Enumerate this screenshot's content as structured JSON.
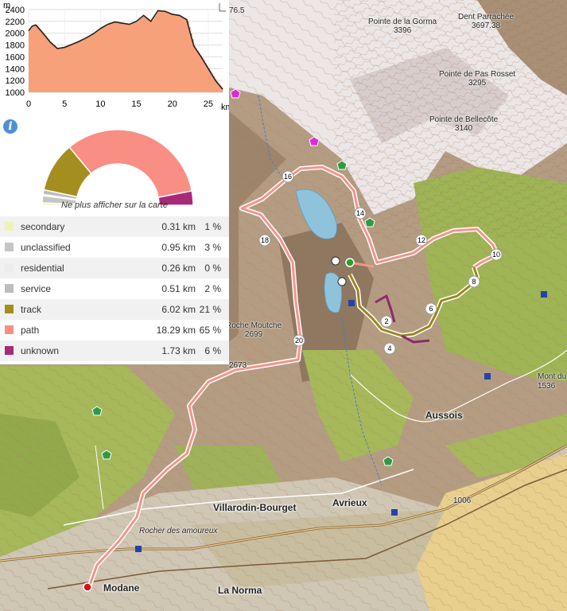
{
  "map": {
    "peaks": [
      {
        "name": "Pointe de la Gorma",
        "alt": "3396"
      },
      {
        "name": "Dent Parrachée",
        "alt": "3697.38"
      },
      {
        "name": "Pointe de Pas Rosset",
        "alt": "3295"
      },
      {
        "name": "Pointe de Bellecôte",
        "alt": "3140"
      },
      {
        "name": "Roche Moutche",
        "alt": "2699"
      }
    ],
    "towns": [
      "Aussois",
      "Villarodin-Bourget",
      "Avrieux",
      "Modane",
      "La Norma"
    ],
    "places": [
      "Rocher des amoureux",
      "Mont du",
      "Aussois"
    ],
    "spot_heights": [
      "2673",
      "1536",
      "76.5",
      "1006"
    ],
    "route_markers": [
      "2",
      "4",
      "6",
      "8",
      "10",
      "12",
      "14",
      "16",
      "18",
      "20"
    ],
    "colors": {
      "route_path": "#f4948c",
      "route_track": "#9a861e",
      "route_unknown": "#8c2a6e",
      "start": "#d11",
      "end": "#2aa02a"
    }
  },
  "elevation": {
    "y_unit": "m",
    "y_ticks": [
      "2400",
      "2200",
      "2000",
      "1800",
      "1600",
      "1400",
      "1200",
      "1000"
    ],
    "x_ticks": [
      "0",
      "5",
      "10",
      "15",
      "20",
      "25"
    ],
    "x_unit": "km"
  },
  "surface": {
    "hide_label": "Ne plus afficher sur la carte",
    "rows": [
      {
        "name": "secondary",
        "km": "0.31 km",
        "pct": "1 %",
        "frac": 0.01,
        "color": "#eef2b8"
      },
      {
        "name": "unclassified",
        "km": "0.95 km",
        "pct": "3 %",
        "frac": 0.03,
        "color": "#c6c6c6"
      },
      {
        "name": "residential",
        "km": "0.26 km",
        "pct": "0 %",
        "frac": 0.005,
        "color": "#ececec"
      },
      {
        "name": "service",
        "km": "0.51 km",
        "pct": "2 %",
        "frac": 0.02,
        "color": "#bdbdbd"
      },
      {
        "name": "track",
        "km": "6.02 km",
        "pct": "21 %",
        "frac": 0.21,
        "color": "#a48e1f"
      },
      {
        "name": "path",
        "km": "18.29 km",
        "pct": "65 %",
        "frac": 0.65,
        "color": "#f98e84"
      },
      {
        "name": "unknown",
        "km": "1.73 km",
        "pct": "6 %",
        "frac": 0.06,
        "color": "#a82a78"
      }
    ]
  },
  "chart_data": {
    "type": "bar",
    "xlabel": "",
    "ylabel": "",
    "x_unit": "km",
    "y_unit": "m",
    "xlim": [
      0,
      27
    ],
    "ylim": [
      1000,
      2400
    ],
    "x": [
      0,
      0.5,
      1,
      2,
      3,
      4,
      5,
      6,
      7,
      8,
      9,
      10,
      11,
      12,
      13,
      14,
      15,
      16,
      17,
      18,
      19,
      20,
      21,
      22,
      22.5,
      23,
      24,
      25,
      26,
      27
    ],
    "values": [
      2040,
      2120,
      2140,
      2000,
      1850,
      1740,
      1760,
      1810,
      1860,
      1920,
      1990,
      2080,
      2150,
      2190,
      2170,
      2150,
      2200,
      2300,
      2200,
      2380,
      2370,
      2320,
      2300,
      2230,
      2000,
      1780,
      1600,
      1400,
      1200,
      1050
    ]
  }
}
